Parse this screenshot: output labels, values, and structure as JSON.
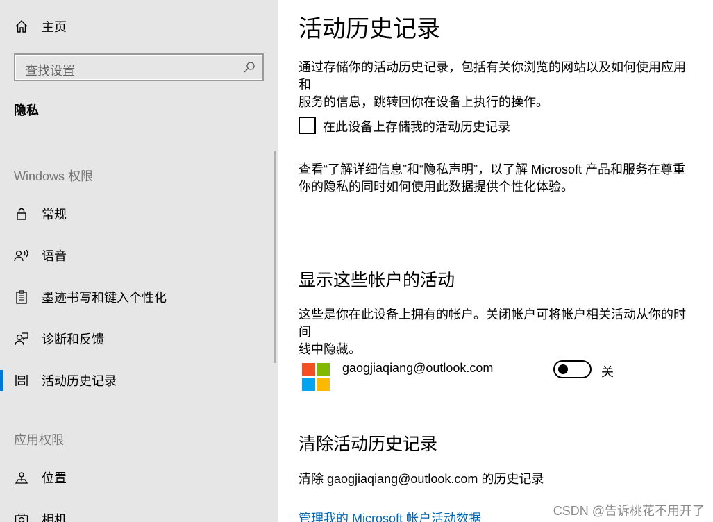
{
  "sidebar": {
    "home_label": "主页",
    "search_placeholder": "查找设置",
    "section_title": "隐私",
    "group_windows": "Windows 权限",
    "items": [
      {
        "label": "常规"
      },
      {
        "label": "语音"
      },
      {
        "label": "墨迹书写和键入个性化"
      },
      {
        "label": "诊断和反馈"
      },
      {
        "label": "活动历史记录",
        "selected": true
      }
    ],
    "group_app": "应用权限",
    "app_items": [
      {
        "label": "位置"
      },
      {
        "label": "相机"
      }
    ]
  },
  "main": {
    "title": "活动历史记录",
    "intro_line1": "通过存储你的活动历史记录，包括有关你浏览的网站以及如何使用应用和",
    "intro_line2": "服务的信息，跳转回你在设备上执行的操作。",
    "checkbox_label": "在此设备上存储我的活动历史记录",
    "checkbox_checked": false,
    "privacy_line1": "查看“了解详细信息”和“隐私声明”，以了解 Microsoft 产品和服务在尊重",
    "privacy_line2": "你的隐私的同时如何使用此数据提供个性化体验。",
    "accounts_heading": "显示这些帐户的活动",
    "accounts_line1": "这些是你在此设备上拥有的帐户。关闭帐户可将帐户相关活动从你的时间",
    "accounts_line2": "线中隐藏。",
    "account_email": "gaogjiaqiang@outlook.com",
    "toggle_state": "关",
    "clear_heading": "清除活动历史记录",
    "clear_text": "清除 gaogjiaqiang@outlook.com 的历史记录",
    "manage_link": "管理我的 Microsoft 帐户活动数据"
  },
  "watermark": "CSDN @告诉桃花不用开了",
  "colors": {
    "accent": "#0078d7",
    "link": "#0066b4",
    "sidebar_bg": "#e6e6e6",
    "ms_red": "#f25022",
    "ms_green": "#7fba00",
    "ms_blue": "#00a4ef",
    "ms_yellow": "#ffb900"
  },
  "icons": [
    "home-icon",
    "search-icon",
    "lock-icon",
    "speech-icon",
    "clipboard-icon",
    "feedback-icon",
    "timeline-icon",
    "location-icon",
    "camera-icon",
    "microsoft-logo-icon"
  ]
}
